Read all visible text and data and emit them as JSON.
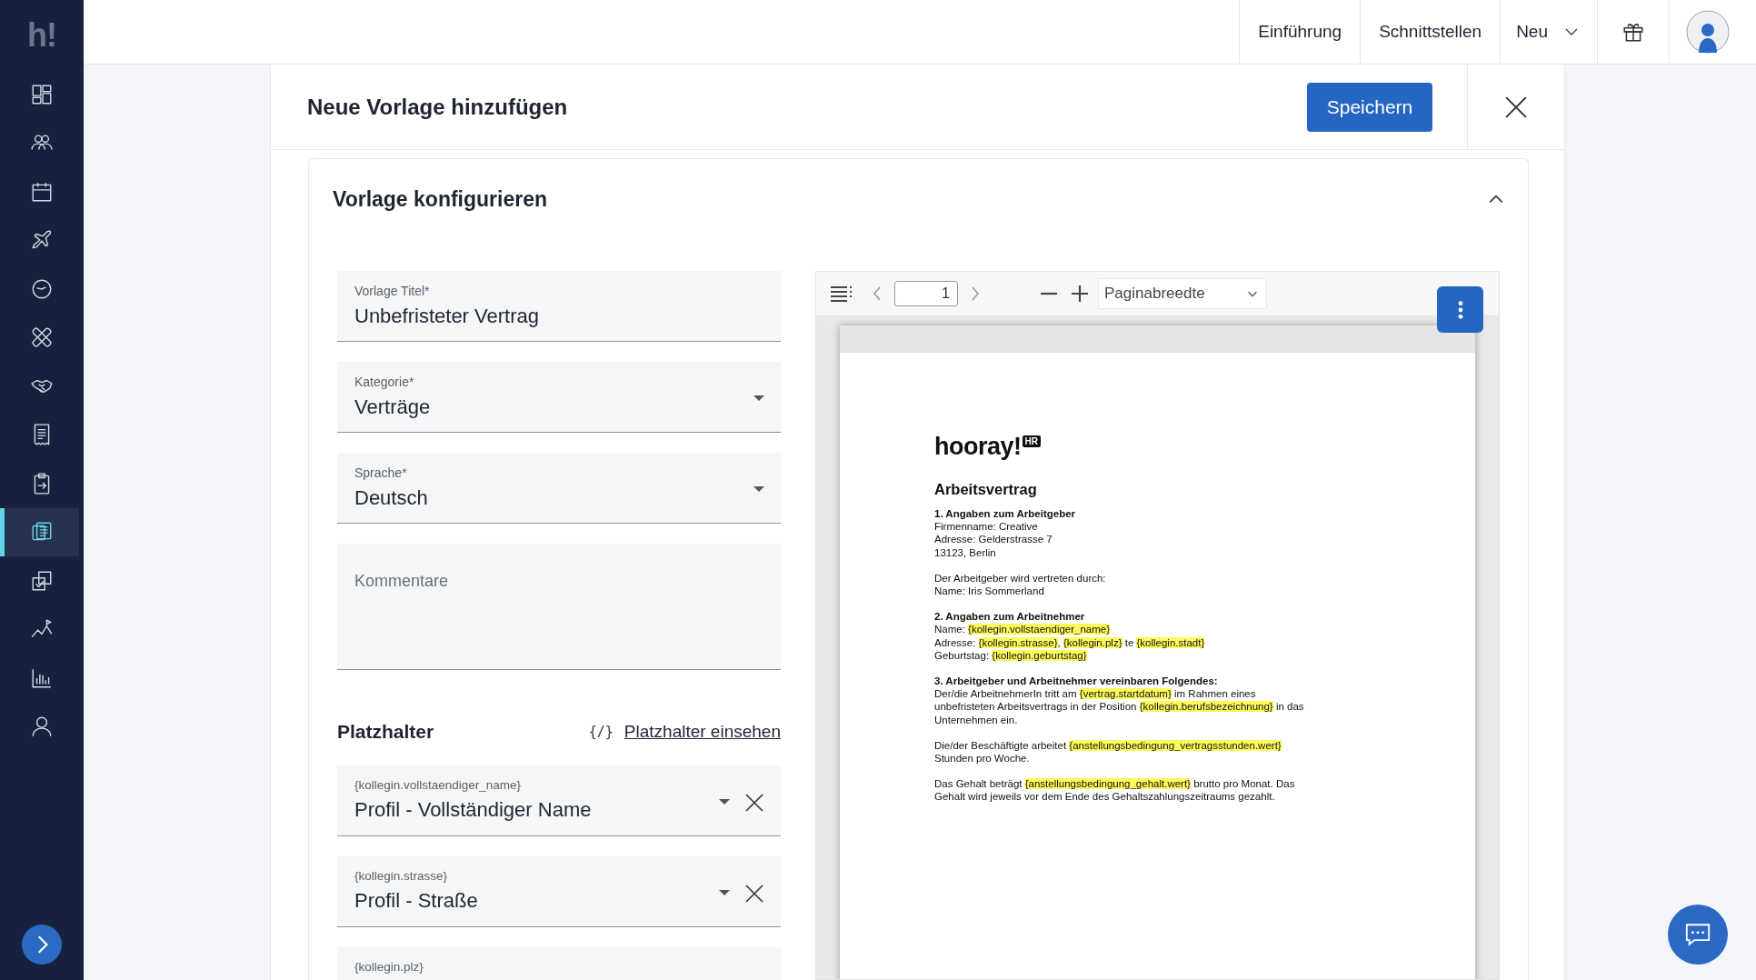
{
  "sidebar": {
    "logo": "h!",
    "items": [
      {
        "kind": "dashboard",
        "selected": false
      },
      {
        "kind": "people",
        "selected": false
      },
      {
        "kind": "calendar",
        "selected": false
      },
      {
        "kind": "plane",
        "selected": false
      },
      {
        "kind": "clock",
        "selected": false
      },
      {
        "kind": "bandage",
        "selected": false
      },
      {
        "kind": "handshake",
        "selected": false
      },
      {
        "kind": "receipt",
        "selected": false
      },
      {
        "kind": "clipboard",
        "selected": false
      },
      {
        "kind": "documents",
        "selected": true
      },
      {
        "kind": "checklist",
        "selected": false
      },
      {
        "kind": "mountain",
        "selected": false
      },
      {
        "kind": "chart",
        "selected": false
      },
      {
        "kind": "person",
        "selected": false
      }
    ]
  },
  "topnav": {
    "links": [
      "Einführung",
      "Schnittstellen"
    ],
    "menu": "Neu"
  },
  "header": {
    "title": "Neue Vorlage hinzufügen",
    "save": "Speichern"
  },
  "section": {
    "title": "Vorlage konfigurieren",
    "expanded": true
  },
  "fields": [
    {
      "kind": "text",
      "label": "Vorlage Titel*",
      "value": "Unbefristeter Vertrag"
    },
    {
      "kind": "select",
      "label": "Kategorie*",
      "value": "Verträge"
    },
    {
      "kind": "select",
      "label": "Sprache*",
      "value": "Deutsch"
    },
    {
      "kind": "textarea",
      "placeholder": "Kommentare"
    }
  ],
  "placeholders": {
    "title": "Platzhalter",
    "icon": "{/}",
    "link": "Platzhalter einsehen",
    "items": [
      {
        "label": "{kollegin.vollstaendiger_name}",
        "value": "Profil - Vollständiger Name"
      },
      {
        "label": "{kollegin.strasse}",
        "value": "Profil - Straße"
      },
      {
        "label": "{kollegin.plz}"
      }
    ]
  },
  "viewer": {
    "page": "1",
    "zoom": "Paginabreedte",
    "document": {
      "logo": "hooray!",
      "logo_badge": "HR",
      "title": "Arbeitsvertrag",
      "blocks": [
        {
          "heading": "1. Angaben zum Arbeitgeber",
          "lines": [
            [
              {
                "text": "Firmenname: Creative",
                "highlight": false
              }
            ],
            [
              {
                "text": "Adresse: Gelderstrasse 7",
                "highlight": false
              }
            ],
            [
              {
                "text": "13123, Berlin",
                "highlight": false
              }
            ]
          ]
        },
        {
          "lines": [
            [
              {
                "text": "Der Arbeitgeber wird vertreten durch:",
                "highlight": false
              }
            ],
            [
              {
                "text": "Name: Iris Sommerland",
                "highlight": false
              }
            ]
          ]
        },
        {
          "heading": "2. Angaben zum Arbeitnehmer",
          "lines": [
            [
              {
                "text": "Name: ",
                "highlight": false
              },
              {
                "text": "{kollegin.vollstaendiger_name}",
                "highlight": true
              }
            ],
            [
              {
                "text": "Adresse: ",
                "highlight": false
              },
              {
                "text": "{kollegin.strasse}",
                "highlight": true
              },
              {
                "text": ", ",
                "highlight": false
              },
              {
                "text": "{kollegin.plz}",
                "highlight": true
              },
              {
                "text": " te ",
                "highlight": false
              },
              {
                "text": "{kollegin.stadt}",
                "highlight": true
              }
            ],
            [
              {
                "text": "Geburtstag: ",
                "highlight": false
              },
              {
                "text": "{kollegin.geburtstag}",
                "highlight": true
              }
            ]
          ]
        },
        {
          "heading": "3. Arbeitgeber und Arbeitnehmer vereinbaren Folgendes:",
          "lines": [
            [
              {
                "text": "Der/die ArbeitnehmerIn tritt am ",
                "highlight": false
              },
              {
                "text": "{vertrag.startdatum}",
                "highlight": true
              },
              {
                "text": " im Rahmen eines",
                "highlight": false
              }
            ],
            [
              {
                "text": "unbefristeten Arbeitsvertrags in der Position ",
                "highlight": false
              },
              {
                "text": "{kollegin.berufsbezeichnung}",
                "highlight": true
              },
              {
                "text": " in das",
                "highlight": false
              }
            ],
            [
              {
                "text": "Unternehmen ein.",
                "highlight": false
              }
            ]
          ]
        },
        {
          "lines": [
            [
              {
                "text": "Die/der Beschäftigte arbeitet ",
                "highlight": false
              },
              {
                "text": "{anstellungsbedingung_vertragsstunden.wert}",
                "highlight": true
              }
            ],
            [
              {
                "text": "Stunden pro Woche.",
                "highlight": false
              }
            ]
          ]
        },
        {
          "lines": [
            [
              {
                "text": "Das Gehalt beträgt ",
                "highlight": false
              },
              {
                "text": "{anstellungsbedingung_gehalt.wert}",
                "highlight": true
              },
              {
                "text": " brutto pro Monat. Das",
                "highlight": false
              }
            ],
            [
              {
                "text": "Gehalt wird jeweils vor dem Ende des Gehaltszahlungszeitraums gezahlt.",
                "highlight": false
              }
            ]
          ]
        }
      ]
    }
  }
}
